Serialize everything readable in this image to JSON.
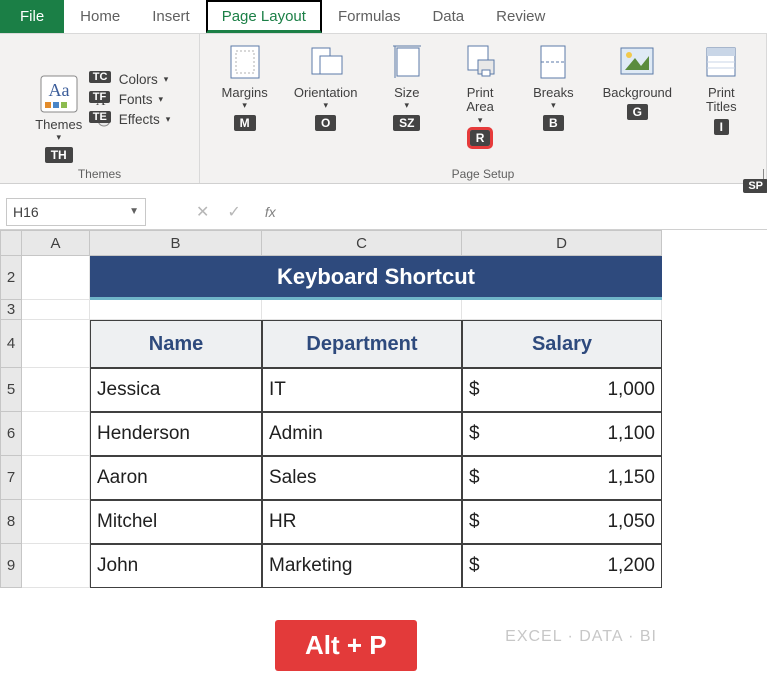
{
  "tabs": {
    "file": "File",
    "home": "Home",
    "insert": "Insert",
    "page_layout": "Page Layout",
    "formulas": "Formulas",
    "data": "Data",
    "review": "Review"
  },
  "ribbon": {
    "themes_group": {
      "themes_label": "Themes",
      "colors_label": "Colors",
      "fonts_label": "Fonts",
      "effects_label": "Effects",
      "group_title": "Themes",
      "hints": {
        "themes": "TH",
        "colors": "TC",
        "fonts": "TF",
        "effects": "TE"
      }
    },
    "page_setup_group": {
      "margins": "Margins",
      "orientation": "Orientation",
      "size": "Size",
      "print_area": "Print\nArea",
      "breaks": "Breaks",
      "background": "Background",
      "print_titles": "Print\nTitles",
      "group_title": "Page Setup",
      "hints": {
        "margins": "M",
        "orientation": "O",
        "size": "SZ",
        "print_area": "R",
        "breaks": "B",
        "background": "G",
        "print_titles": "I",
        "sp": "SP"
      }
    }
  },
  "namebox": "H16",
  "fx_label": "fx",
  "columns": [
    "A",
    "B",
    "C",
    "D"
  ],
  "rows": [
    "2",
    "3",
    "4",
    "5",
    "6",
    "7",
    "8",
    "9"
  ],
  "sheet": {
    "title": "Keyboard Shortcut",
    "headers": {
      "name": "Name",
      "department": "Department",
      "salary": "Salary"
    },
    "data": [
      {
        "name": "Jessica",
        "dept": "IT",
        "cur": "$",
        "sal": "1,000"
      },
      {
        "name": "Henderson",
        "dept": "Admin",
        "cur": "$",
        "sal": "1,100"
      },
      {
        "name": "Aaron",
        "dept": "Sales",
        "cur": "$",
        "sal": "1,150"
      },
      {
        "name": "Mitchel",
        "dept": "HR",
        "cur": "$",
        "sal": "1,050"
      },
      {
        "name": "John",
        "dept": "Marketing",
        "cur": "$",
        "sal": "1,200"
      }
    ]
  },
  "callout": "Alt + P",
  "watermark": "EXCEL · DATA · BI"
}
